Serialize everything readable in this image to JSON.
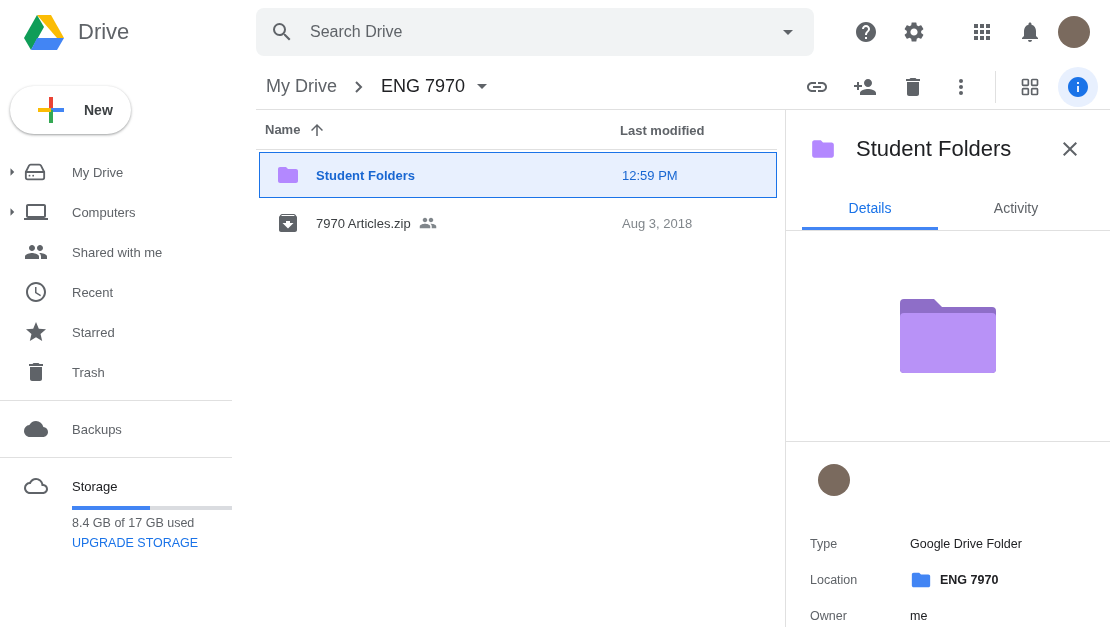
{
  "app": {
    "name": "Drive"
  },
  "search": {
    "placeholder": "Search Drive"
  },
  "new_button": {
    "label": "New"
  },
  "sidebar": {
    "items": [
      {
        "label": "My Drive",
        "expandable": true
      },
      {
        "label": "Computers",
        "expandable": true
      },
      {
        "label": "Shared with me",
        "expandable": false
      },
      {
        "label": "Recent",
        "expandable": false
      },
      {
        "label": "Starred",
        "expandable": false
      },
      {
        "label": "Trash",
        "expandable": false
      }
    ],
    "backups": {
      "label": "Backups"
    },
    "storage": {
      "label": "Storage",
      "level": 0.49,
      "usage": "8.4 GB of 17 GB used",
      "upgrade": "UPGRADE STORAGE"
    }
  },
  "breadcrumb": [
    "My Drive",
    "ENG 7970"
  ],
  "info_active": true,
  "table": {
    "columns": [
      "Name",
      "Last modified"
    ],
    "rows": [
      {
        "name": "Student Folders",
        "kind": "folder",
        "shared": false,
        "modified": "12:59 PM",
        "selected": true
      },
      {
        "name": "7970 Articles.zip",
        "kind": "archive",
        "shared": true,
        "modified": "Aug 3, 2018",
        "selected": false
      }
    ]
  },
  "details": {
    "title": "Student Folders",
    "tabs": [
      {
        "label": "Details",
        "selected": true
      },
      {
        "label": "Activity",
        "selected": false
      }
    ],
    "properties": [
      {
        "label": "Type",
        "value": "Google Drive Folder",
        "kind": "text"
      },
      {
        "label": "Location",
        "value": "ENG 7970",
        "kind": "folder"
      },
      {
        "label": "Owner",
        "value": "me",
        "kind": "text"
      }
    ]
  }
}
